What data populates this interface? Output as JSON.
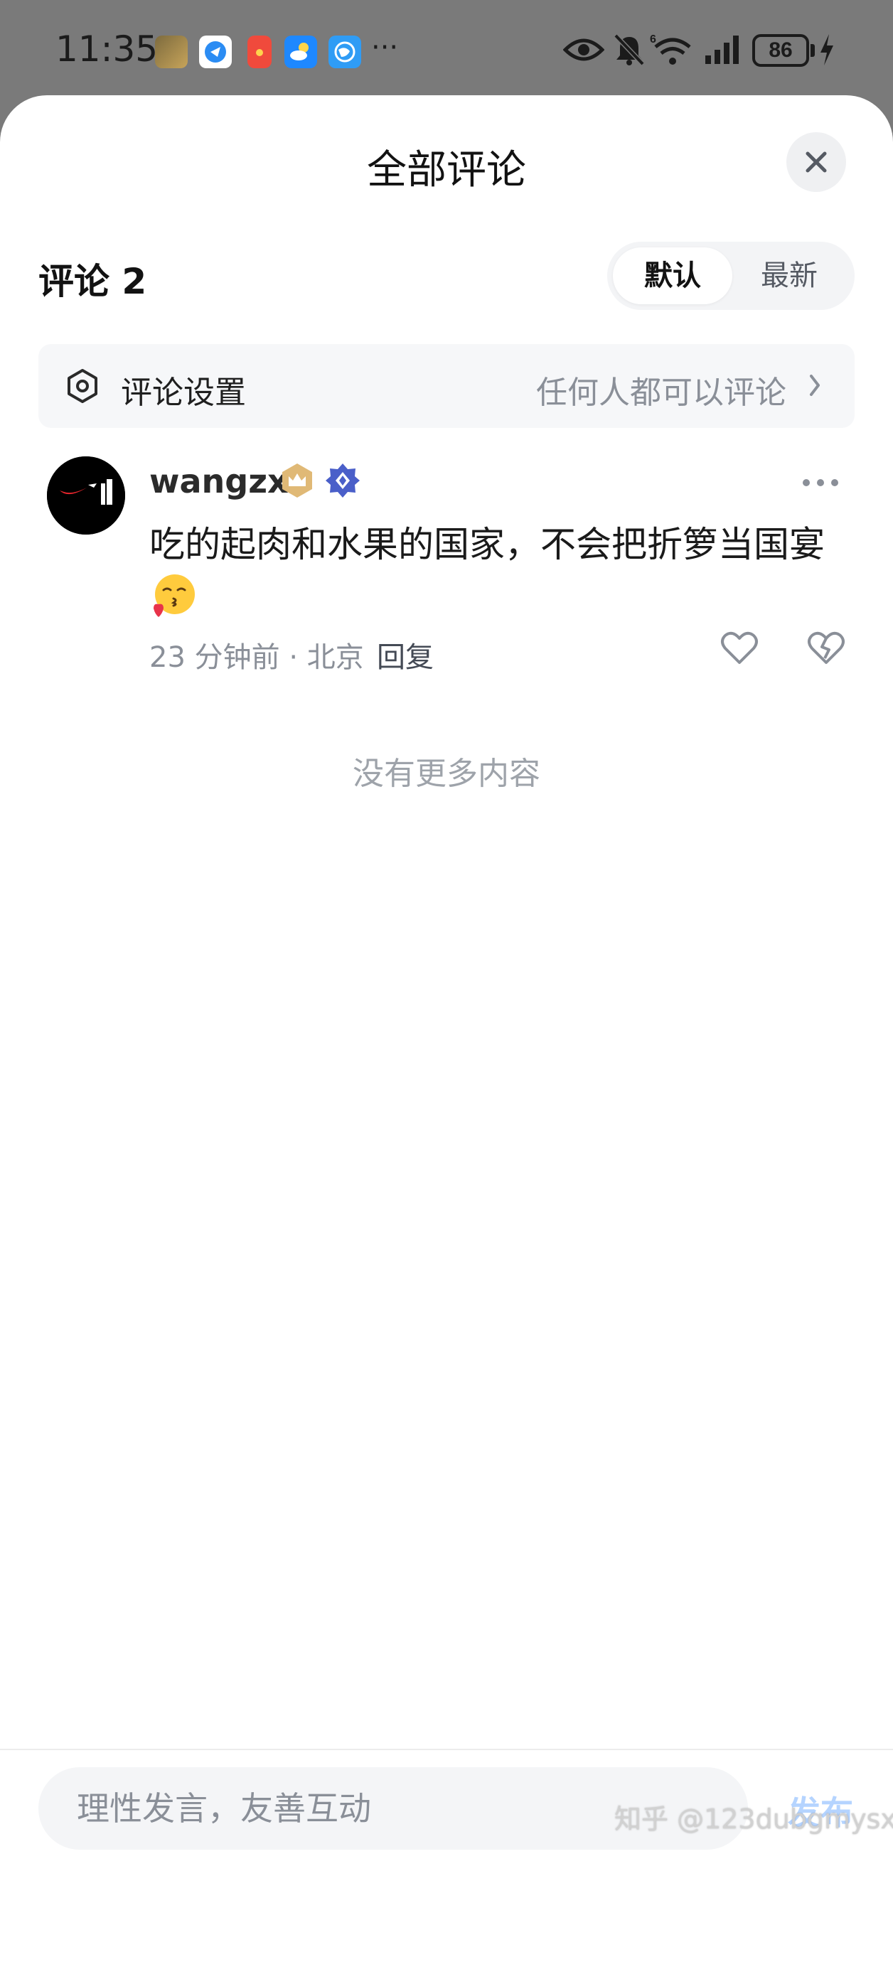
{
  "status_bar": {
    "time": "11:35",
    "more_indicator": "···",
    "battery_level": "86"
  },
  "sheet": {
    "title": "全部评论",
    "close_icon": "close-icon"
  },
  "comments_header": {
    "count_label": "评论 2",
    "sort_options": [
      "默认",
      "最新"
    ],
    "selected_sort": "默认"
  },
  "settings": {
    "label": "评论设置",
    "value": "任何人都可以评论",
    "icon": "settings-icon"
  },
  "comments": [
    {
      "username": "wangzx",
      "text": "吃的起肉和水果的国家，不会把折箩当国宴",
      "emoji": "kissing-face-emoji",
      "meta": "23 分钟前 · 北京",
      "reply_label": "回复"
    }
  ],
  "footer_note": "没有更多内容",
  "input_bar": {
    "placeholder": "理性发言，友善互动",
    "publish_label": "发布"
  },
  "watermark": "知乎 @123dubgmysx",
  "colors": {
    "accent_disabled": "#b5d4ff",
    "muted_text": "#8a8f98",
    "status_bar_bg": "#7a7a7a"
  }
}
